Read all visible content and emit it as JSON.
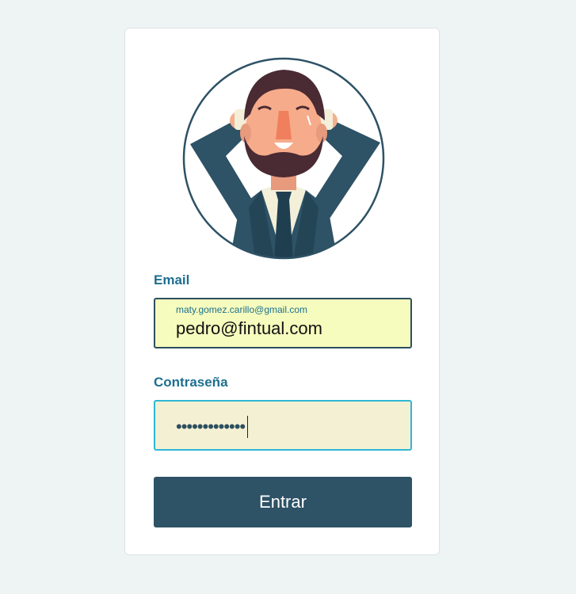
{
  "form": {
    "email_label": "Email",
    "email_autofill_hint": "maty.gomez.carillo@gmail.com",
    "email_value": "pedro@fintual.com",
    "password_label": "Contraseña",
    "password_masked": "•••••••••••••",
    "submit_label": "Entrar"
  },
  "avatar": {
    "icon": "user-avatar-illustration"
  },
  "colors": {
    "page_background": "#eef3f3",
    "label": "#1d6f8f",
    "button": "#2e5266",
    "email_field": "#f6fcbd",
    "password_field": "#f4f0d3",
    "focus_border": "#2fb6d4"
  }
}
